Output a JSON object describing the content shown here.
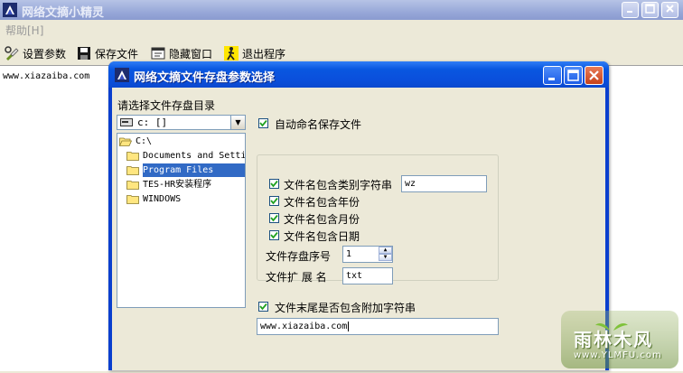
{
  "main_window": {
    "title": "网络文摘小精灵",
    "menu": {
      "help_label": "帮助[H]"
    },
    "toolbar": {
      "settings_label": "设置参数",
      "save_label": "保存文件",
      "hide_label": "隐藏窗口",
      "exit_label": "退出程序"
    },
    "content_text": "www.xiazaiba.com",
    "buttons": {
      "minimize": "_",
      "maximize": "□",
      "close": "×"
    }
  },
  "dialog": {
    "title": "网络文摘文件存盘参数选择",
    "dir_prompt": "请选择文件存盘目录",
    "drive": {
      "value": "c: []"
    },
    "directory_list": {
      "items": [
        {
          "label": "C:\\",
          "open": true,
          "selected": false
        },
        {
          "label": "Documents and Setti",
          "open": false,
          "selected": false
        },
        {
          "label": "Program Files",
          "open": false,
          "selected": true
        },
        {
          "label": "TES-HR安装程序",
          "open": false,
          "selected": false
        },
        {
          "label": "WINDOWS",
          "open": false,
          "selected": false
        }
      ]
    },
    "auto_name": {
      "label": "自动命名保存文件",
      "checked": true
    },
    "options": {
      "category_char": {
        "label": "文件名包含类别字符串",
        "checked": true,
        "value": "wz"
      },
      "year": {
        "label": "文件名包含年份",
        "checked": true
      },
      "month": {
        "label": "文件名包含月份",
        "checked": true
      },
      "day": {
        "label": "文件名包含日期",
        "checked": true
      },
      "sequence": {
        "label": "文件存盘序号",
        "value": "1"
      },
      "extension": {
        "label": "文件扩 展 名",
        "value": "txt"
      }
    },
    "suffix": {
      "label": "文件末尾是否包含附加字符串",
      "checked": true,
      "value": "www.xiazaiba.com"
    }
  },
  "watermark": {
    "brand": "雨林木风",
    "url": "www.YLMFU.com"
  },
  "colors": {
    "dialog_title": "#0a4fdc",
    "selection": "#316ac5",
    "window_bg": "#ece9d8"
  }
}
